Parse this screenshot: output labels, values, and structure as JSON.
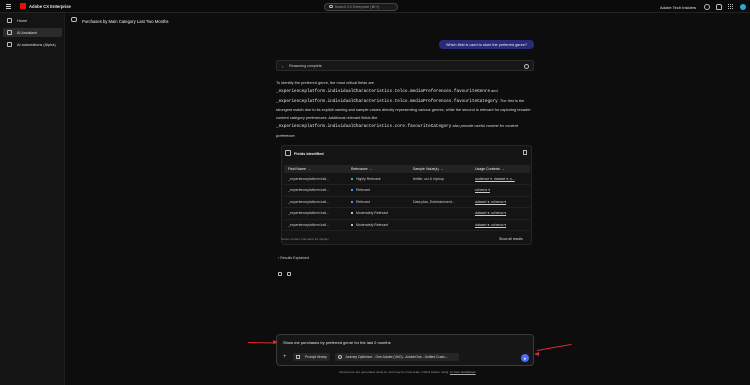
{
  "topbar": {
    "brand": "Adobe CX Enterprise",
    "search_placeholder": "Search CX Enterprise (⌘+/)",
    "org": "Adobe Tech Insiders",
    "colors": {
      "logo": "#eb1000",
      "avatar": "#2ea6d6"
    }
  },
  "sidebar": {
    "items": [
      {
        "label": "Home",
        "icon": "home-icon"
      },
      {
        "label": "AI Assistant",
        "icon": "ai-assistant-icon"
      },
      {
        "label": "AI automations (Alpha)",
        "icon": "automation-icon"
      }
    ]
  },
  "conversation": {
    "title": "Purchases by Main Category Last Two Months",
    "user_message": "Which field is used to store the preferred genre?",
    "reasoning_label": "Reasoning complete",
    "answer": {
      "p1": "To identify the preferred genre, the most critical fields are",
      "field1": "_experienceplatform.individualCharacteristics.telco.mediaPreferences.favouriteGenre",
      "and": " and",
      "field2": "_experienceplatform.individualCharacteristics.telco.mediaPreferences.favouriteCategory",
      "p2": ". The first is the strongest match due to its explicit naming and sample values directly representing various genres, while the second is relevant for capturing broader content category preferences. Additional relevant fields like",
      "field3": "_experienceplatform.individualCharacteristics.core.favouriteCategory",
      "p3": "also provide useful context for content preference."
    }
  },
  "fields_card": {
    "title": "Fields Identified",
    "columns": [
      "Field Name",
      "Relevance",
      "Sample Value(s)",
      "Usage Contexts"
    ],
    "rows": [
      {
        "field": "_experienceplatform.indi...",
        "relevance": "Highly Relevant",
        "dot": "#2fbf71",
        "sample": "thriller, sci-fi, hiphop",
        "usage": "audience ▾, dataset ▾, s..."
      },
      {
        "field": "_experienceplatform.indi...",
        "relevance": "Relevant",
        "dot": "#4b8dff",
        "sample": "",
        "usage": "schema ▾"
      },
      {
        "field": "_experienceplatform.indi...",
        "relevance": "Relevant",
        "dot": "#4b8dff",
        "sample": "Data plan, Entertainment...",
        "usage": "dataset ▾, schema ▾"
      },
      {
        "field": "_experienceplatform.indi...",
        "relevance": "Moderately Relevant",
        "dot": "#bdbdbd",
        "sample": "",
        "usage": "dataset ▾, schema ▾"
      },
      {
        "field": "_experienceplatform.indi...",
        "relevance": "Moderately Relevant",
        "dot": "#bdbdbd",
        "sample": "",
        "usage": "dataset ▾, schema ▾"
      }
    ],
    "truncated_note": "Some content truncated for display",
    "show_all": "Show all results"
  },
  "results_explained": "Results Explained",
  "prompt": {
    "text": "Show me purchases by preferred genre for the last 2 months",
    "prompt_library": "Prompt library",
    "sandbox": "Journey Optimizer - One Adobe (VAO) - AdobeOne - Unified Custo...",
    "send_color": "#4b6bff"
  },
  "disclaimer": {
    "text": "Responses are generated using AI, and may be inaccurate. Check before using.",
    "link": "AI User Guidelines"
  }
}
